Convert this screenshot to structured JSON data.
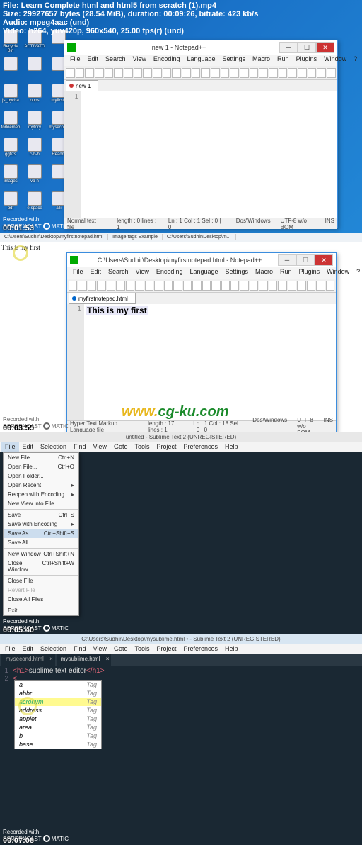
{
  "info_overlay": {
    "file": "File: Learn Complete html and html5 from scratch (1).mp4",
    "size": "Size: 29927657 bytes (28.54 MiB), duration: 00:09:26, bitrate: 423 kb/s",
    "audio": "Audio: mpeg4aac (und)",
    "video": "Video: h264, yuv420p, 960x540, 25.00 fps(r) (und)"
  },
  "screencast": {
    "recorded": "Recorded with",
    "brand_a": "SCREENCAST",
    "brand_b": "MATIC"
  },
  "desktop_icons": [
    "Recycle Bin",
    "ACTIVATO",
    "",
    "",
    "",
    "",
    "js_pycha",
    "oops",
    "myfirst1",
    "forloemeo",
    "myfory",
    "mysecond",
    "ggfizs",
    "c-b-h",
    "Readm",
    "images",
    "vb-h",
    "",
    "pdf",
    "e-space",
    "alli"
  ],
  "sec1": {
    "title": "new  1 - Notepad++",
    "menus": [
      "File",
      "Edit",
      "Search",
      "View",
      "Encoding",
      "Language",
      "Settings",
      "Macro",
      "Run",
      "Plugins",
      "Window",
      "?"
    ],
    "tab": "new 1",
    "gutter": "1",
    "code": "",
    "status": {
      "type": "Normal text file",
      "length": "length : 0    lines : 1",
      "pos": "Ln : 1    Col : 1    Sel : 0 | 0",
      "eol": "Dos\\Windows",
      "enc": "UTF-8 w/o BOM",
      "ins": "INS"
    },
    "timestamp": "00:01:53"
  },
  "sec2": {
    "tabs": [
      "C:\\Users\\Sudhir\\Desktop\\myfirstnotepad.html",
      "Image tags Example",
      "C:\\Users\\Sudhir\\Desktop\\m..."
    ],
    "rendered": "This is my first",
    "npp_title": "C:\\Users\\Sudhir\\Desktop\\myfirstnotepad.html - Notepad++",
    "menus": [
      "File",
      "Edit",
      "Search",
      "View",
      "Encoding",
      "Language",
      "Settings",
      "Macro",
      "Run",
      "Plugins",
      "Window",
      "?"
    ],
    "tab": "myfirstnotepad.html",
    "gutter": "1",
    "code": "This is my first",
    "status": {
      "type": "Hyper Text Markup Language file",
      "length": "length : 17    lines : 1",
      "pos": "Ln : 1    Col : 18    Sel : 0 | 0",
      "eol": "Dos\\Windows",
      "enc": "UTF-8 w/o BOM",
      "ins": "INS"
    },
    "timestamp": "00:03:55",
    "watermark_a": "www.",
    "watermark_b": "cg-ku.com"
  },
  "sec3": {
    "title": "untitled - Sublime Text 2 (UNREGISTERED)",
    "menus": [
      "File",
      "Edit",
      "Selection",
      "Find",
      "View",
      "Goto",
      "Tools",
      "Project",
      "Preferences",
      "Help"
    ],
    "menu_items": [
      {
        "label": "New File",
        "shortcut": "Ctrl+N"
      },
      {
        "label": "Open File...",
        "shortcut": "Ctrl+O"
      },
      {
        "label": "Open Folder...",
        "shortcut": ""
      },
      {
        "label": "Open Recent",
        "shortcut": "",
        "arrow": true
      },
      {
        "label": "Reopen with Encoding",
        "shortcut": "",
        "arrow": true
      },
      {
        "label": "New View into File",
        "shortcut": ""
      },
      {
        "sep": true
      },
      {
        "label": "Save",
        "shortcut": "Ctrl+S"
      },
      {
        "label": "Save with Encoding",
        "shortcut": "",
        "arrow": true
      },
      {
        "label": "Save As...",
        "shortcut": "Ctrl+Shift+S",
        "hover": true
      },
      {
        "label": "Save All",
        "shortcut": ""
      },
      {
        "sep": true
      },
      {
        "label": "New Window",
        "shortcut": "Ctrl+Shift+N"
      },
      {
        "label": "Close Window",
        "shortcut": "Ctrl+Shift+W"
      },
      {
        "sep": true
      },
      {
        "label": "Close File",
        "shortcut": ""
      },
      {
        "label": "Revert File",
        "shortcut": "",
        "disabled": true
      },
      {
        "label": "Close All Files",
        "shortcut": ""
      },
      {
        "sep": true
      },
      {
        "label": "Exit",
        "shortcut": ""
      }
    ],
    "timestamp": "00:05:40"
  },
  "sec4": {
    "title": "C:\\Users\\Sudhir\\Desktop\\mysublime.html • - Sublime Text 2 (UNREGISTERED)",
    "menus": [
      "File",
      "Edit",
      "Selection",
      "Find",
      "View",
      "Goto",
      "Tools",
      "Project",
      "Preferences",
      "Help"
    ],
    "tabs": [
      "mysecond.html",
      "mysublime.html"
    ],
    "line1_ln": "1",
    "line1_open": "<h1>",
    "line1_txt": "sublime text editor",
    "line1_close": "</h1>",
    "line2_ln": "2",
    "line2_txt": "<",
    "autocomplete": [
      {
        "v": "a",
        "t": "Tag"
      },
      {
        "v": "abbr",
        "t": "Tag"
      },
      {
        "v": "acronym",
        "t": "Tag",
        "sel": true
      },
      {
        "v": "address",
        "t": "Tag"
      },
      {
        "v": "applet",
        "t": "Tag"
      },
      {
        "v": "area",
        "t": "Tag"
      },
      {
        "v": "b",
        "t": "Tag"
      },
      {
        "v": "base",
        "t": "Tag"
      }
    ],
    "timestamp": "00:07:08"
  }
}
